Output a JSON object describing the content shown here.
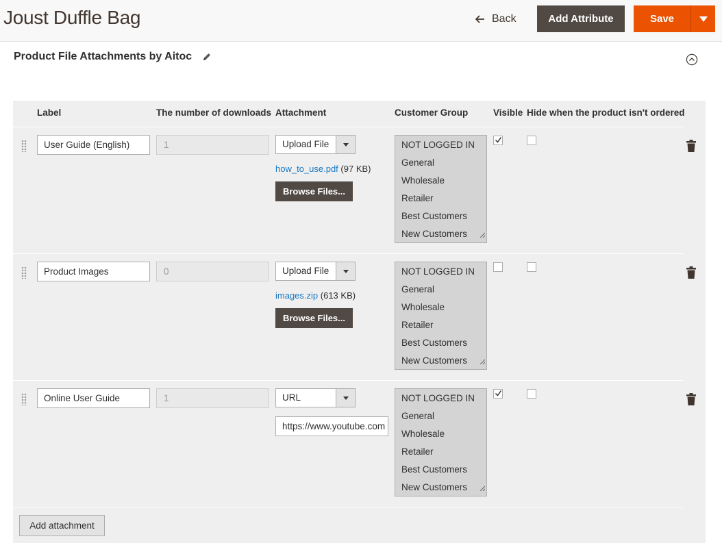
{
  "header": {
    "title": "Joust Duffle Bag",
    "back_label": "Back",
    "add_attribute_label": "Add Attribute",
    "save_label": "Save"
  },
  "section": {
    "title": "Product File Attachments by Aitoc"
  },
  "table": {
    "columns": {
      "label": "Label",
      "downloads": "The number of downloads",
      "attachment": "Attachment",
      "customer_group": "Customer Group",
      "visible": "Visible",
      "hide": "Hide when the product isn't ordered"
    },
    "customer_groups": [
      "NOT LOGGED IN",
      "General",
      "Wholesale",
      "Retailer",
      "Best Customers",
      "New Customers"
    ],
    "browse_label": "Browse Files...",
    "rows": [
      {
        "label": "User Guide (English)",
        "downloads": "1",
        "attachment_type": "Upload File",
        "file_name": "how_to_use.pdf",
        "file_size": "(97 KB)",
        "visible": true,
        "hide_when_not_ordered": false
      },
      {
        "label": "Product Images",
        "downloads": "0",
        "attachment_type": "Upload File",
        "file_name": "images.zip",
        "file_size": "(613 KB)",
        "visible": false,
        "hide_when_not_ordered": false
      },
      {
        "label": "Online User Guide",
        "downloads": "1",
        "attachment_type": "URL",
        "url": "https://www.youtube.com",
        "visible": true,
        "hide_when_not_ordered": false
      }
    ],
    "add_attachment_label": "Add attachment"
  },
  "colors": {
    "primary_orange": "#eb5202",
    "dark_button": "#514943",
    "link_blue": "#1979c3",
    "table_bg": "#efefef"
  }
}
